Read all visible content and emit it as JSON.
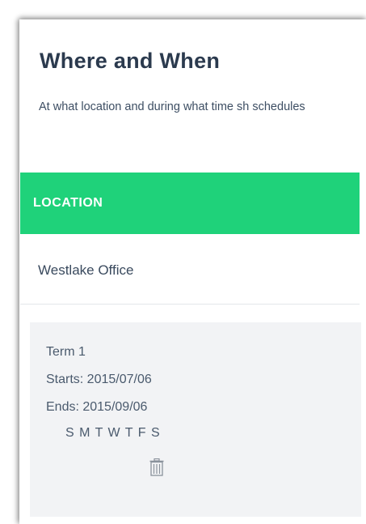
{
  "section": {
    "title": "Where and When",
    "description": "At what location and during what time sh schedules"
  },
  "table": {
    "header_label": "LOCATION",
    "header_color": "#1fd27a",
    "location_name": "Westlake Office"
  },
  "term": {
    "title": "Term 1",
    "starts": "Starts: 2015/07/06",
    "ends": "Ends: 2015/09/06",
    "days": "S M T W T F S",
    "delete_icon": "trash-icon"
  }
}
